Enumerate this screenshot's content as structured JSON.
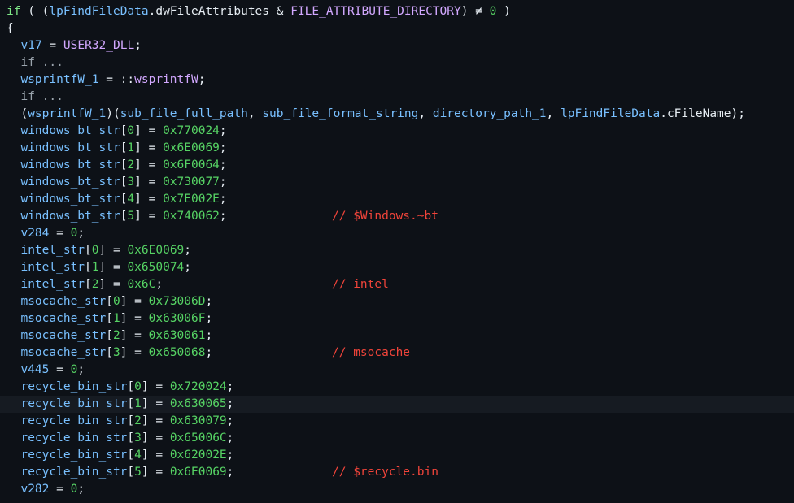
{
  "colors": {
    "background": "#0d1117",
    "highlight_line": "#161b22",
    "keyword": "#7ee787",
    "variable": "#79c0ff",
    "function": "#d2a8ff",
    "number": "#56d364",
    "constant": "#d2a8ff",
    "comment": "#f0443a",
    "text": "#e6edf3"
  },
  "highlighted_line": 23,
  "code_lines": [
    {
      "tokens": [
        {
          "t": "if",
          "c": "#7ee787"
        },
        {
          "t": " ( (",
          "c": "#e6edf3"
        },
        {
          "t": "lpFindFileData",
          "c": "#79c0ff"
        },
        {
          "t": ".dwFileAttributes & ",
          "c": "#e6edf3"
        },
        {
          "t": "FILE_ATTRIBUTE_DIRECTORY",
          "c": "#d2a8ff"
        },
        {
          "t": ") ≠ ",
          "c": "#e6edf3"
        },
        {
          "t": "0",
          "c": "#56d364"
        },
        {
          "t": " )",
          "c": "#e6edf3"
        }
      ]
    },
    {
      "tokens": [
        {
          "t": "{",
          "c": "#e6edf3"
        }
      ]
    },
    {
      "tokens": [
        {
          "t": "  ",
          "c": "#e6edf3"
        },
        {
          "t": "v17",
          "c": "#79c0ff"
        },
        {
          "t": " = ",
          "c": "#e6edf3"
        },
        {
          "t": "USER32_DLL",
          "c": "#d2a8ff"
        },
        {
          "t": ";",
          "c": "#e6edf3"
        }
      ]
    },
    {
      "tokens": [
        {
          "t": "  if ",
          "c": "#9aa4ad"
        },
        {
          "t": "...",
          "c": "#9aa4ad"
        }
      ],
      "fold": true
    },
    {
      "tokens": [
        {
          "t": "  ",
          "c": "#e6edf3"
        },
        {
          "t": "wsprintfW_1",
          "c": "#79c0ff"
        },
        {
          "t": " = ::",
          "c": "#e6edf3"
        },
        {
          "t": "wsprintfW",
          "c": "#d2a8ff"
        },
        {
          "t": ";",
          "c": "#e6edf3"
        }
      ]
    },
    {
      "tokens": [
        {
          "t": "  if ",
          "c": "#9aa4ad"
        },
        {
          "t": "...",
          "c": "#9aa4ad"
        }
      ],
      "fold": true
    },
    {
      "tokens": [
        {
          "t": "  (",
          "c": "#e6edf3"
        },
        {
          "t": "wsprintfW_1",
          "c": "#79c0ff"
        },
        {
          "t": ")(",
          "c": "#e6edf3"
        },
        {
          "t": "sub_file_full_path",
          "c": "#79c0ff"
        },
        {
          "t": ", ",
          "c": "#e6edf3"
        },
        {
          "t": "sub_file_format_string",
          "c": "#79c0ff"
        },
        {
          "t": ", ",
          "c": "#e6edf3"
        },
        {
          "t": "directory_path_1",
          "c": "#79c0ff"
        },
        {
          "t": ", ",
          "c": "#e6edf3"
        },
        {
          "t": "lpFindFileData",
          "c": "#79c0ff"
        },
        {
          "t": ".cFileName);",
          "c": "#e6edf3"
        }
      ]
    },
    {
      "tokens": [
        {
          "t": "  ",
          "c": "#e6edf3"
        },
        {
          "t": "windows_bt_str",
          "c": "#79c0ff"
        },
        {
          "t": "[",
          "c": "#e6edf3"
        },
        {
          "t": "0",
          "c": "#56d364"
        },
        {
          "t": "] = ",
          "c": "#e6edf3"
        },
        {
          "t": "0x770024",
          "c": "#56d364"
        },
        {
          "t": ";",
          "c": "#e6edf3"
        }
      ]
    },
    {
      "tokens": [
        {
          "t": "  ",
          "c": "#e6edf3"
        },
        {
          "t": "windows_bt_str",
          "c": "#79c0ff"
        },
        {
          "t": "[",
          "c": "#e6edf3"
        },
        {
          "t": "1",
          "c": "#56d364"
        },
        {
          "t": "] = ",
          "c": "#e6edf3"
        },
        {
          "t": "0x6E0069",
          "c": "#56d364"
        },
        {
          "t": ";",
          "c": "#e6edf3"
        }
      ]
    },
    {
      "tokens": [
        {
          "t": "  ",
          "c": "#e6edf3"
        },
        {
          "t": "windows_bt_str",
          "c": "#79c0ff"
        },
        {
          "t": "[",
          "c": "#e6edf3"
        },
        {
          "t": "2",
          "c": "#56d364"
        },
        {
          "t": "] = ",
          "c": "#e6edf3"
        },
        {
          "t": "0x6F0064",
          "c": "#56d364"
        },
        {
          "t": ";",
          "c": "#e6edf3"
        }
      ]
    },
    {
      "tokens": [
        {
          "t": "  ",
          "c": "#e6edf3"
        },
        {
          "t": "windows_bt_str",
          "c": "#79c0ff"
        },
        {
          "t": "[",
          "c": "#e6edf3"
        },
        {
          "t": "3",
          "c": "#56d364"
        },
        {
          "t": "] = ",
          "c": "#e6edf3"
        },
        {
          "t": "0x730077",
          "c": "#56d364"
        },
        {
          "t": ";",
          "c": "#e6edf3"
        }
      ]
    },
    {
      "tokens": [
        {
          "t": "  ",
          "c": "#e6edf3"
        },
        {
          "t": "windows_bt_str",
          "c": "#79c0ff"
        },
        {
          "t": "[",
          "c": "#e6edf3"
        },
        {
          "t": "4",
          "c": "#56d364"
        },
        {
          "t": "] = ",
          "c": "#e6edf3"
        },
        {
          "t": "0x7E002E",
          "c": "#56d364"
        },
        {
          "t": ";",
          "c": "#e6edf3"
        }
      ]
    },
    {
      "tokens": [
        {
          "t": "  ",
          "c": "#e6edf3"
        },
        {
          "t": "windows_bt_str",
          "c": "#79c0ff"
        },
        {
          "t": "[",
          "c": "#e6edf3"
        },
        {
          "t": "5",
          "c": "#56d364"
        },
        {
          "t": "] = ",
          "c": "#e6edf3"
        },
        {
          "t": "0x740062",
          "c": "#56d364"
        },
        {
          "t": ";",
          "c": "#e6edf3"
        }
      ],
      "comment": "// $Windows.~bt"
    },
    {
      "tokens": [
        {
          "t": "  ",
          "c": "#e6edf3"
        },
        {
          "t": "v284",
          "c": "#79c0ff"
        },
        {
          "t": " = ",
          "c": "#e6edf3"
        },
        {
          "t": "0",
          "c": "#56d364"
        },
        {
          "t": ";",
          "c": "#e6edf3"
        }
      ]
    },
    {
      "tokens": [
        {
          "t": "  ",
          "c": "#e6edf3"
        },
        {
          "t": "intel_str",
          "c": "#79c0ff"
        },
        {
          "t": "[",
          "c": "#e6edf3"
        },
        {
          "t": "0",
          "c": "#56d364"
        },
        {
          "t": "] = ",
          "c": "#e6edf3"
        },
        {
          "t": "0x6E0069",
          "c": "#56d364"
        },
        {
          "t": ";",
          "c": "#e6edf3"
        }
      ]
    },
    {
      "tokens": [
        {
          "t": "  ",
          "c": "#e6edf3"
        },
        {
          "t": "intel_str",
          "c": "#79c0ff"
        },
        {
          "t": "[",
          "c": "#e6edf3"
        },
        {
          "t": "1",
          "c": "#56d364"
        },
        {
          "t": "] = ",
          "c": "#e6edf3"
        },
        {
          "t": "0x650074",
          "c": "#56d364"
        },
        {
          "t": ";",
          "c": "#e6edf3"
        }
      ]
    },
    {
      "tokens": [
        {
          "t": "  ",
          "c": "#e6edf3"
        },
        {
          "t": "intel_str",
          "c": "#79c0ff"
        },
        {
          "t": "[",
          "c": "#e6edf3"
        },
        {
          "t": "2",
          "c": "#56d364"
        },
        {
          "t": "] = ",
          "c": "#e6edf3"
        },
        {
          "t": "0x6C",
          "c": "#56d364"
        },
        {
          "t": ";",
          "c": "#e6edf3"
        }
      ],
      "comment": "// intel"
    },
    {
      "tokens": [
        {
          "t": "  ",
          "c": "#e6edf3"
        },
        {
          "t": "msocache_str",
          "c": "#79c0ff"
        },
        {
          "t": "[",
          "c": "#e6edf3"
        },
        {
          "t": "0",
          "c": "#56d364"
        },
        {
          "t": "] = ",
          "c": "#e6edf3"
        },
        {
          "t": "0x73006D",
          "c": "#56d364"
        },
        {
          "t": ";",
          "c": "#e6edf3"
        }
      ]
    },
    {
      "tokens": [
        {
          "t": "  ",
          "c": "#e6edf3"
        },
        {
          "t": "msocache_str",
          "c": "#79c0ff"
        },
        {
          "t": "[",
          "c": "#e6edf3"
        },
        {
          "t": "1",
          "c": "#56d364"
        },
        {
          "t": "] = ",
          "c": "#e6edf3"
        },
        {
          "t": "0x63006F",
          "c": "#56d364"
        },
        {
          "t": ";",
          "c": "#e6edf3"
        }
      ]
    },
    {
      "tokens": [
        {
          "t": "  ",
          "c": "#e6edf3"
        },
        {
          "t": "msocache_str",
          "c": "#79c0ff"
        },
        {
          "t": "[",
          "c": "#e6edf3"
        },
        {
          "t": "2",
          "c": "#56d364"
        },
        {
          "t": "] = ",
          "c": "#e6edf3"
        },
        {
          "t": "0x630061",
          "c": "#56d364"
        },
        {
          "t": ";",
          "c": "#e6edf3"
        }
      ]
    },
    {
      "tokens": [
        {
          "t": "  ",
          "c": "#e6edf3"
        },
        {
          "t": "msocache_str",
          "c": "#79c0ff"
        },
        {
          "t": "[",
          "c": "#e6edf3"
        },
        {
          "t": "3",
          "c": "#56d364"
        },
        {
          "t": "] = ",
          "c": "#e6edf3"
        },
        {
          "t": "0x650068",
          "c": "#56d364"
        },
        {
          "t": ";",
          "c": "#e6edf3"
        }
      ],
      "comment": "// msocache"
    },
    {
      "tokens": [
        {
          "t": "  ",
          "c": "#e6edf3"
        },
        {
          "t": "v445",
          "c": "#79c0ff"
        },
        {
          "t": " = ",
          "c": "#e6edf3"
        },
        {
          "t": "0",
          "c": "#56d364"
        },
        {
          "t": ";",
          "c": "#e6edf3"
        }
      ]
    },
    {
      "tokens": [
        {
          "t": "  ",
          "c": "#e6edf3"
        },
        {
          "t": "recycle_bin_str",
          "c": "#79c0ff"
        },
        {
          "t": "[",
          "c": "#e6edf3"
        },
        {
          "t": "0",
          "c": "#56d364"
        },
        {
          "t": "] = ",
          "c": "#e6edf3"
        },
        {
          "t": "0x720024",
          "c": "#56d364"
        },
        {
          "t": ";",
          "c": "#e6edf3"
        }
      ]
    },
    {
      "tokens": [
        {
          "t": "  ",
          "c": "#e6edf3"
        },
        {
          "t": "recycle_bin_str",
          "c": "#79c0ff"
        },
        {
          "t": "[",
          "c": "#e6edf3"
        },
        {
          "t": "1",
          "c": "#56d364"
        },
        {
          "t": "] = ",
          "c": "#e6edf3"
        },
        {
          "t": "0x630065",
          "c": "#56d364"
        },
        {
          "t": ";",
          "c": "#e6edf3"
        }
      ]
    },
    {
      "tokens": [
        {
          "t": "  ",
          "c": "#e6edf3"
        },
        {
          "t": "recycle_bin_str",
          "c": "#79c0ff"
        },
        {
          "t": "[",
          "c": "#e6edf3"
        },
        {
          "t": "2",
          "c": "#56d364"
        },
        {
          "t": "] = ",
          "c": "#e6edf3"
        },
        {
          "t": "0x630079",
          "c": "#56d364"
        },
        {
          "t": ";",
          "c": "#e6edf3"
        }
      ]
    },
    {
      "tokens": [
        {
          "t": "  ",
          "c": "#e6edf3"
        },
        {
          "t": "recycle_bin_str",
          "c": "#79c0ff"
        },
        {
          "t": "[",
          "c": "#e6edf3"
        },
        {
          "t": "3",
          "c": "#56d364"
        },
        {
          "t": "] = ",
          "c": "#e6edf3"
        },
        {
          "t": "0x65006C",
          "c": "#56d364"
        },
        {
          "t": ";",
          "c": "#e6edf3"
        }
      ]
    },
    {
      "tokens": [
        {
          "t": "  ",
          "c": "#e6edf3"
        },
        {
          "t": "recycle_bin_str",
          "c": "#79c0ff"
        },
        {
          "t": "[",
          "c": "#e6edf3"
        },
        {
          "t": "4",
          "c": "#56d364"
        },
        {
          "t": "] = ",
          "c": "#e6edf3"
        },
        {
          "t": "0x62002E",
          "c": "#56d364"
        },
        {
          "t": ";",
          "c": "#e6edf3"
        }
      ]
    },
    {
      "tokens": [
        {
          "t": "  ",
          "c": "#e6edf3"
        },
        {
          "t": "recycle_bin_str",
          "c": "#79c0ff"
        },
        {
          "t": "[",
          "c": "#e6edf3"
        },
        {
          "t": "5",
          "c": "#56d364"
        },
        {
          "t": "] = ",
          "c": "#e6edf3"
        },
        {
          "t": "0x6E0069",
          "c": "#56d364"
        },
        {
          "t": ";",
          "c": "#e6edf3"
        }
      ],
      "comment": "// $recycle.bin"
    },
    {
      "tokens": [
        {
          "t": "  ",
          "c": "#e6edf3"
        },
        {
          "t": "v282",
          "c": "#79c0ff"
        },
        {
          "t": " = ",
          "c": "#e6edf3"
        },
        {
          "t": "0",
          "c": "#56d364"
        },
        {
          "t": ";",
          "c": "#e6edf3"
        }
      ]
    }
  ]
}
